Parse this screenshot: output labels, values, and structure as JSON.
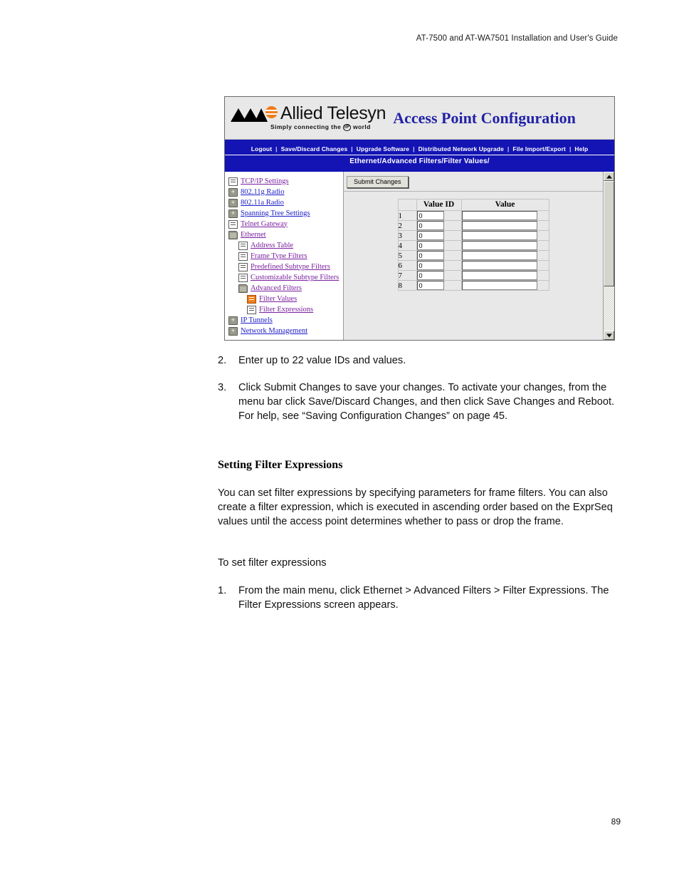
{
  "document": {
    "header": "AT-7500 and AT-WA7501  Installation and User's Guide",
    "page_number": "89"
  },
  "screenshot": {
    "banner": {
      "logo_word": "Allied Telesyn",
      "logo_tagline_before": "Simply  connecting  the",
      "logo_tagline_ip": "IP",
      "logo_tagline_after": "world",
      "title": "Access Point Configuration",
      "brand_blue": "#2222a8",
      "logo_orange": "#f07d1a"
    },
    "menubar": {
      "nav_blue": "#1414b4",
      "items": [
        "Logout",
        "Save/Discard Changes",
        "Upgrade Software",
        "Distributed Network Upgrade",
        "File Import/Export",
        "Help"
      ],
      "separator": "|"
    },
    "breadcrumb": "Ethernet/Advanced Filters/Filter Values/",
    "tree": {
      "items": [
        {
          "label": "TCP/IP Settings",
          "icon": "document-icon",
          "indent": 0,
          "state": "visited"
        },
        {
          "label": "802.11g Radio",
          "icon": "folder-plus-icon",
          "indent": 0,
          "state": "unvisited"
        },
        {
          "label": "802.11a Radio",
          "icon": "folder-plus-icon",
          "indent": 0,
          "state": "unvisited"
        },
        {
          "label": "Spanning Tree Settings",
          "icon": "folder-plus-icon",
          "indent": 0,
          "state": "unvisited"
        },
        {
          "label": "Telnet Gateway",
          "icon": "document-icon",
          "indent": 0,
          "state": "visited"
        },
        {
          "label": "Ethernet",
          "icon": "folder-open-icon",
          "indent": 0,
          "state": "visited"
        },
        {
          "label": "Address Table",
          "icon": "document-icon",
          "indent": 1,
          "state": "visited"
        },
        {
          "label": "Frame Type Filters",
          "icon": "document-icon",
          "indent": 1,
          "state": "visited"
        },
        {
          "label": "Predefined Subtype Filters",
          "icon": "document-icon",
          "indent": 1,
          "state": "visited"
        },
        {
          "label": "Customizable Subtype Filters",
          "icon": "document-icon",
          "indent": 1,
          "state": "visited"
        },
        {
          "label": "Advanced Filters",
          "icon": "folder-open-icon",
          "indent": 1,
          "state": "visited"
        },
        {
          "label": "Filter Values",
          "icon": "document-active-icon",
          "indent": 2,
          "state": "current"
        },
        {
          "label": "Filter Expressions",
          "icon": "document-icon",
          "indent": 2,
          "state": "visited"
        },
        {
          "label": "IP Tunnels",
          "icon": "folder-plus-icon",
          "indent": 0,
          "state": "unvisited"
        },
        {
          "label": "Network Management",
          "icon": "folder-plus-icon",
          "indent": 0,
          "state": "unvisited"
        }
      ]
    },
    "content": {
      "submit_button": "Submit Changes",
      "table": {
        "headers": [
          "",
          "Value ID",
          "Value"
        ],
        "rows": [
          {
            "num": "1",
            "value_id": "0",
            "value": ""
          },
          {
            "num": "2",
            "value_id": "0",
            "value": ""
          },
          {
            "num": "3",
            "value_id": "0",
            "value": ""
          },
          {
            "num": "4",
            "value_id": "0",
            "value": ""
          },
          {
            "num": "5",
            "value_id": "0",
            "value": ""
          },
          {
            "num": "6",
            "value_id": "0",
            "value": ""
          },
          {
            "num": "7",
            "value_id": "0",
            "value": ""
          },
          {
            "num": "8",
            "value_id": "0",
            "value": ""
          }
        ]
      }
    }
  },
  "body": {
    "step2": {
      "num": "2.",
      "text": "Enter up to 22 value IDs and values."
    },
    "step3": {
      "num": "3.",
      "text": "Click Submit Changes to save your changes. To activate your changes, from the menu bar click Save/Discard Changes, and then click Save Changes and Reboot. For help, see “Saving Configuration Changes” on page 45."
    },
    "section_heading": "Setting Filter Expressions",
    "para1": "You can set filter expressions by specifying parameters for frame filters. You can also create a filter expression, which is executed in ascending order based on the ExprSeq values until the access point determines whether to pass or drop the frame.",
    "para2": "To set filter expressions",
    "step1": {
      "num": "1.",
      "text": "From the main menu, click Ethernet > Advanced Filters > Filter Expressions. The Filter Expressions screen appears."
    }
  }
}
